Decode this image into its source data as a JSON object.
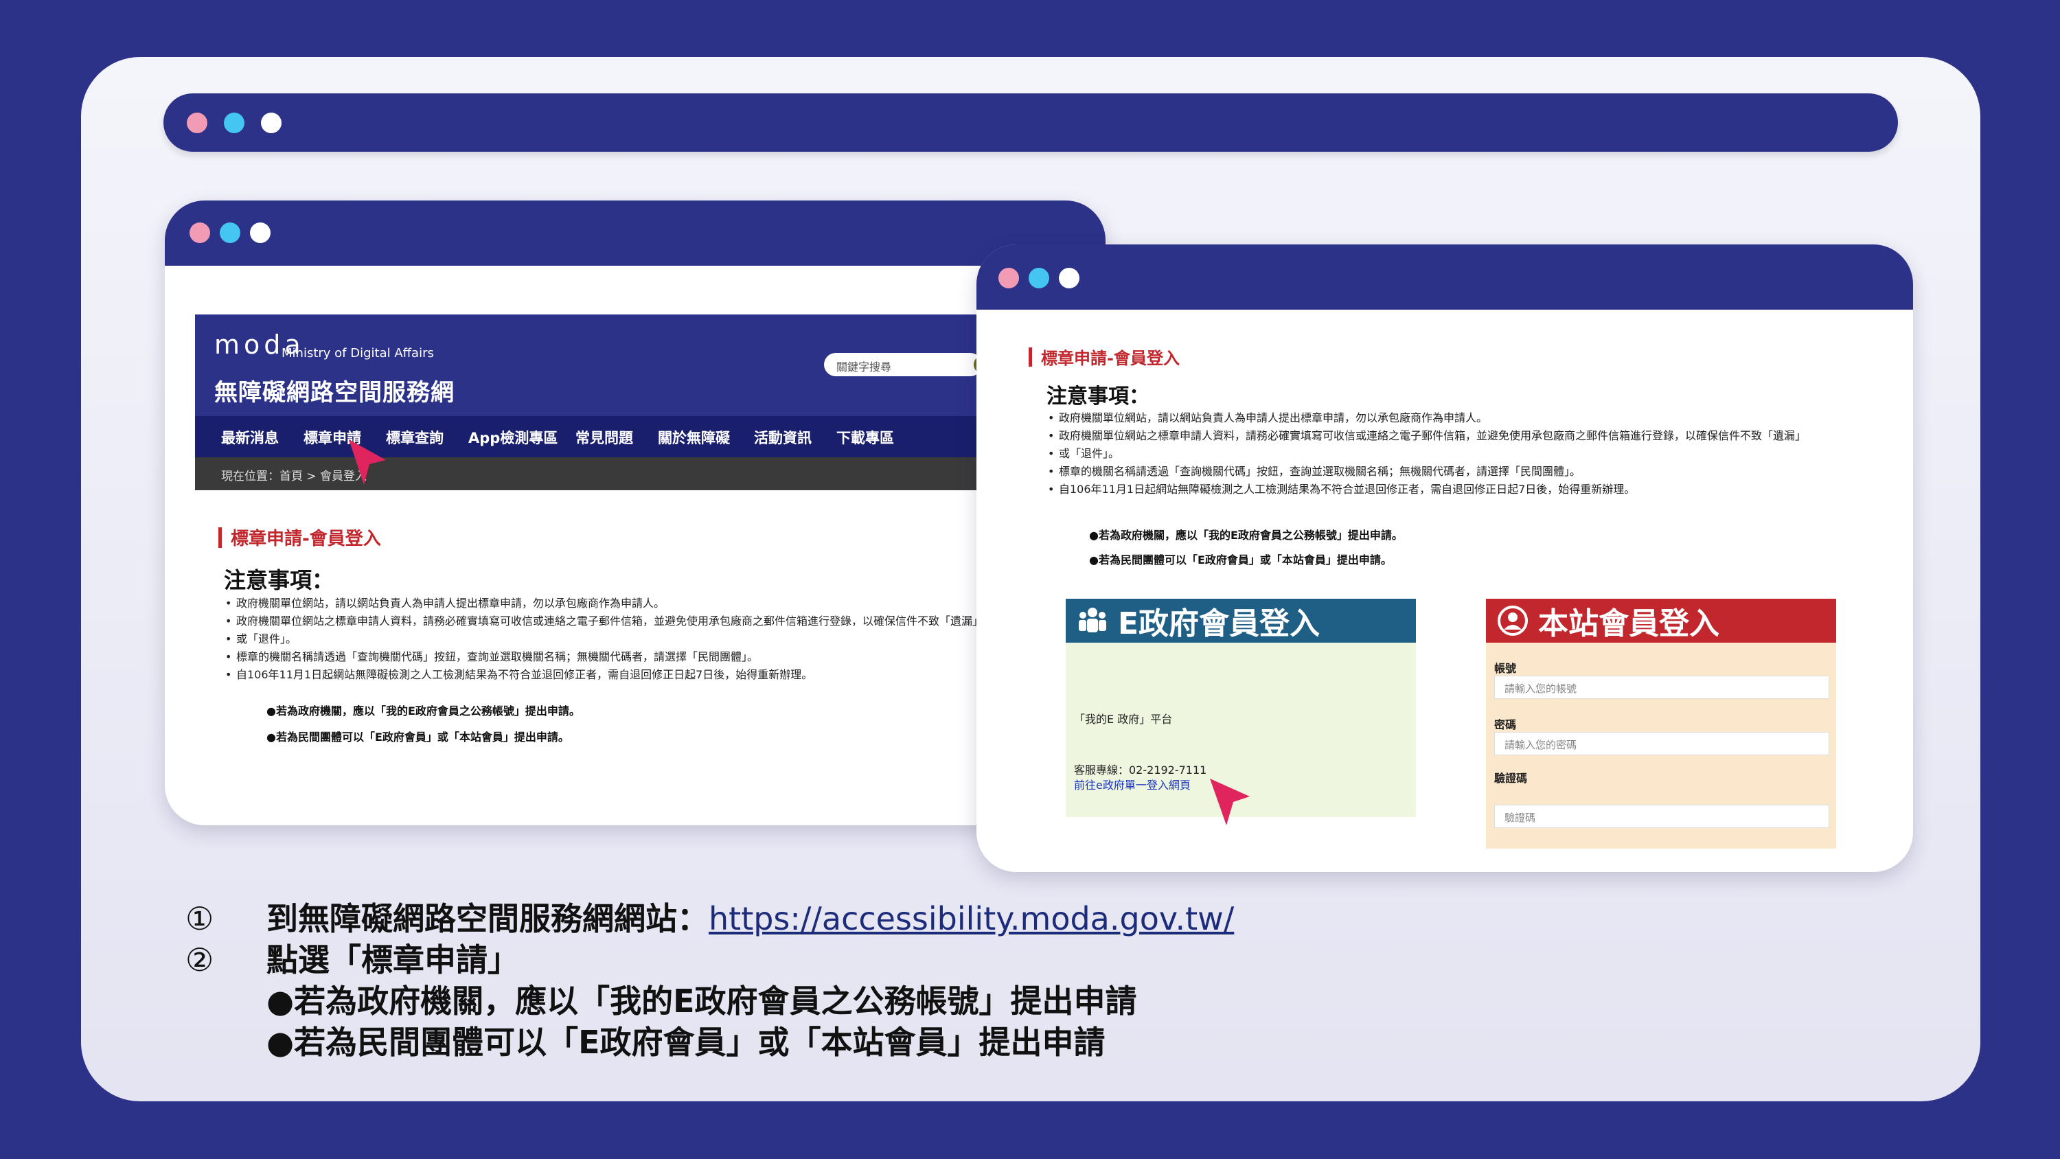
{
  "left_window": {
    "logo": "moda",
    "ministry": "Ministry of Digital Affairs",
    "site_title": "無障礙網路空間服務網",
    "search_placeholder": "關鍵字搜尋",
    "nav": [
      "最新消息",
      "標章申請",
      "標章查詢",
      "App檢測專區",
      "常見問題",
      "關於無障礙",
      "活動資訊",
      "下載專區"
    ],
    "breadcrumb": "現在位置：首頁 > 會員登入",
    "section_title": "標章申請-會員登入",
    "notice_heading": "注意事項：",
    "bullets": [
      "政府機關單位網站，請以網站負責人為申請人提出標章申請，勿以承包廠商作為申請人。",
      "政府機關單位網站之標章申請人資料，請務必確實填寫可收信或連絡之電子郵件信箱，並避免使用承包廠商之郵件信箱進行登錄，以確保信件不致「遺漏」",
      "或「退件」。",
      "標章的機關名稱請透過「查詢機關代碼」按鈕，查詢並選取機關名稱；無機關代碼者，請選擇「民間團體」。",
      "自106年11月1日起網站無障礙檢測之人工檢測結果為不符合並退回修正者，需自退回修正日起7日後，始得重新辦理。"
    ],
    "note_gov": "●若為政府機關，應以「我的E政府會員之公務帳號」提出申請。",
    "note_private": "●若為民間團體可以「E政府會員」或「本站會員」提出申請。"
  },
  "right_window": {
    "section_title": "標章申請-會員登入",
    "notice_heading": "注意事項：",
    "bullets": [
      "政府機關單位網站，請以網站負責人為申請人提出標章申請，勿以承包廠商作為申請人。",
      "政府機關單位網站之標章申請人資料，請務必確實填寫可收信或連絡之電子郵件信箱，並避免使用承包廠商之郵件信箱進行登錄，以確保信件不致「遺漏」",
      "或「退件」。",
      "標章的機關名稱請透過「查詢機關代碼」按鈕，查詢並選取機關名稱；無機關代碼者，請選擇「民間團體」。",
      "自106年11月1日起網站無障礙檢測之人工檢測結果為不符合並退回修正者，需自退回修正日起7日後，始得重新辦理。"
    ],
    "note_gov": "●若為政府機關，應以「我的E政府會員之公務帳號」提出申請。",
    "note_private": "●若為民間團體可以「E政府會員」或「本站會員」提出申請。",
    "gov_panel": {
      "title": "E政府會員登入",
      "platform": "「我的E 政府」平台",
      "hotline": "客服專線：02-2192-7111",
      "link": "前往e政府單一登入網頁"
    },
    "site_panel": {
      "title": "本站會員登入",
      "account_label": "帳號",
      "account_placeholder": "請輸入您的帳號",
      "password_label": "密碼",
      "password_placeholder": "請輸入您的密碼",
      "captcha_label": "驗證碼",
      "captcha_placeholder": "驗證碼"
    }
  },
  "steps": {
    "step1_num": "①",
    "step1_text": "到無障礙網路空間服務網網站：",
    "step1_link": "https://accessibility.moda.gov.tw/",
    "step2_num": "②",
    "step2_text": "點選「標章申請」",
    "step2_sub1": "●若為政府機關，應以「我的E政府會員之公務帳號」提出申請",
    "step2_sub2": "●若為民間團體可以「E政府會員」或「本站會員」提出申請"
  },
  "colors": {
    "background": "#2b3288",
    "accent_red": "#c1272d",
    "gov_blue": "#1f5f86",
    "cursor": "#e0245e"
  }
}
